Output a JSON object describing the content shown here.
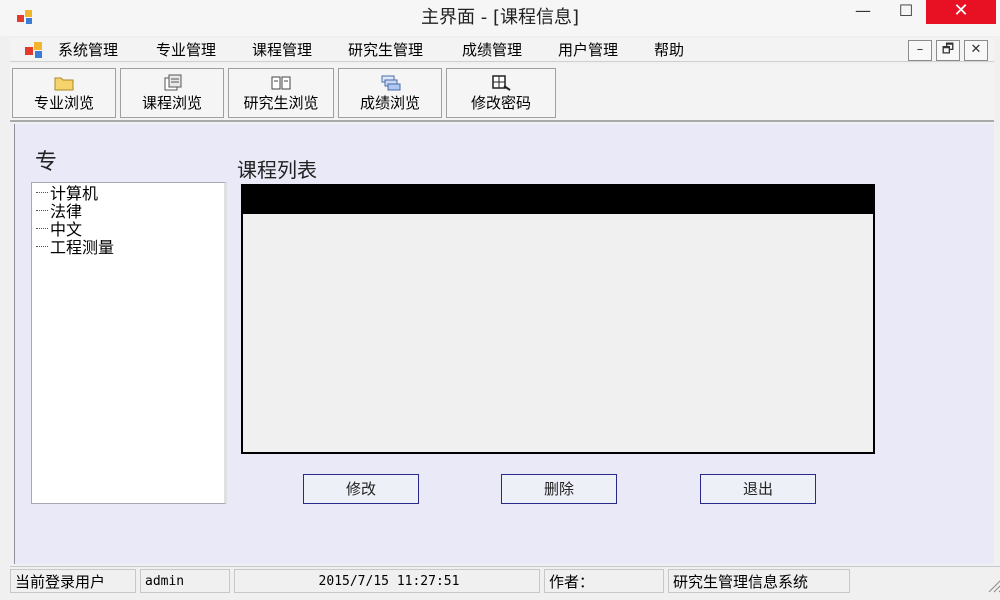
{
  "window": {
    "title": "主界面 - [课程信息]",
    "minimize_glyph": "—",
    "maximize_glyph": "☐",
    "close_glyph": "✕"
  },
  "menu": {
    "items": [
      "系统管理",
      "专业管理",
      "课程管理",
      "研究生管理",
      "成绩管理",
      "用户管理",
      "帮助"
    ],
    "mdi_minimize": "–",
    "mdi_restore": "🗗",
    "mdi_close": "✕"
  },
  "toolbar": {
    "buttons": [
      {
        "label": "专业浏览",
        "icon": "folder-icon"
      },
      {
        "label": "课程浏览",
        "icon": "course-icon"
      },
      {
        "label": "研究生浏览",
        "icon": "book-icon"
      },
      {
        "label": "成绩浏览",
        "icon": "stack-icon"
      },
      {
        "label": "修改密码",
        "icon": "key-icon"
      }
    ]
  },
  "left_panel": {
    "heading": "专",
    "tree": [
      "计算机",
      "法律",
      "中文",
      "工程测量"
    ]
  },
  "main": {
    "list_heading": "课程列表",
    "buttons": {
      "edit": "修改",
      "delete": "删除",
      "exit": "退出"
    }
  },
  "status": {
    "user_label": "当前登录用户",
    "user": "admin",
    "datetime": "2015/7/15 11:27:51",
    "author_label": "作者：",
    "author": "",
    "system_name": "研究生管理信息系统"
  },
  "colors": {
    "close_button": "#e81123",
    "client_background": "#e9e9f7",
    "grid_header": "#000000",
    "button_border": "#2a2a8a"
  }
}
